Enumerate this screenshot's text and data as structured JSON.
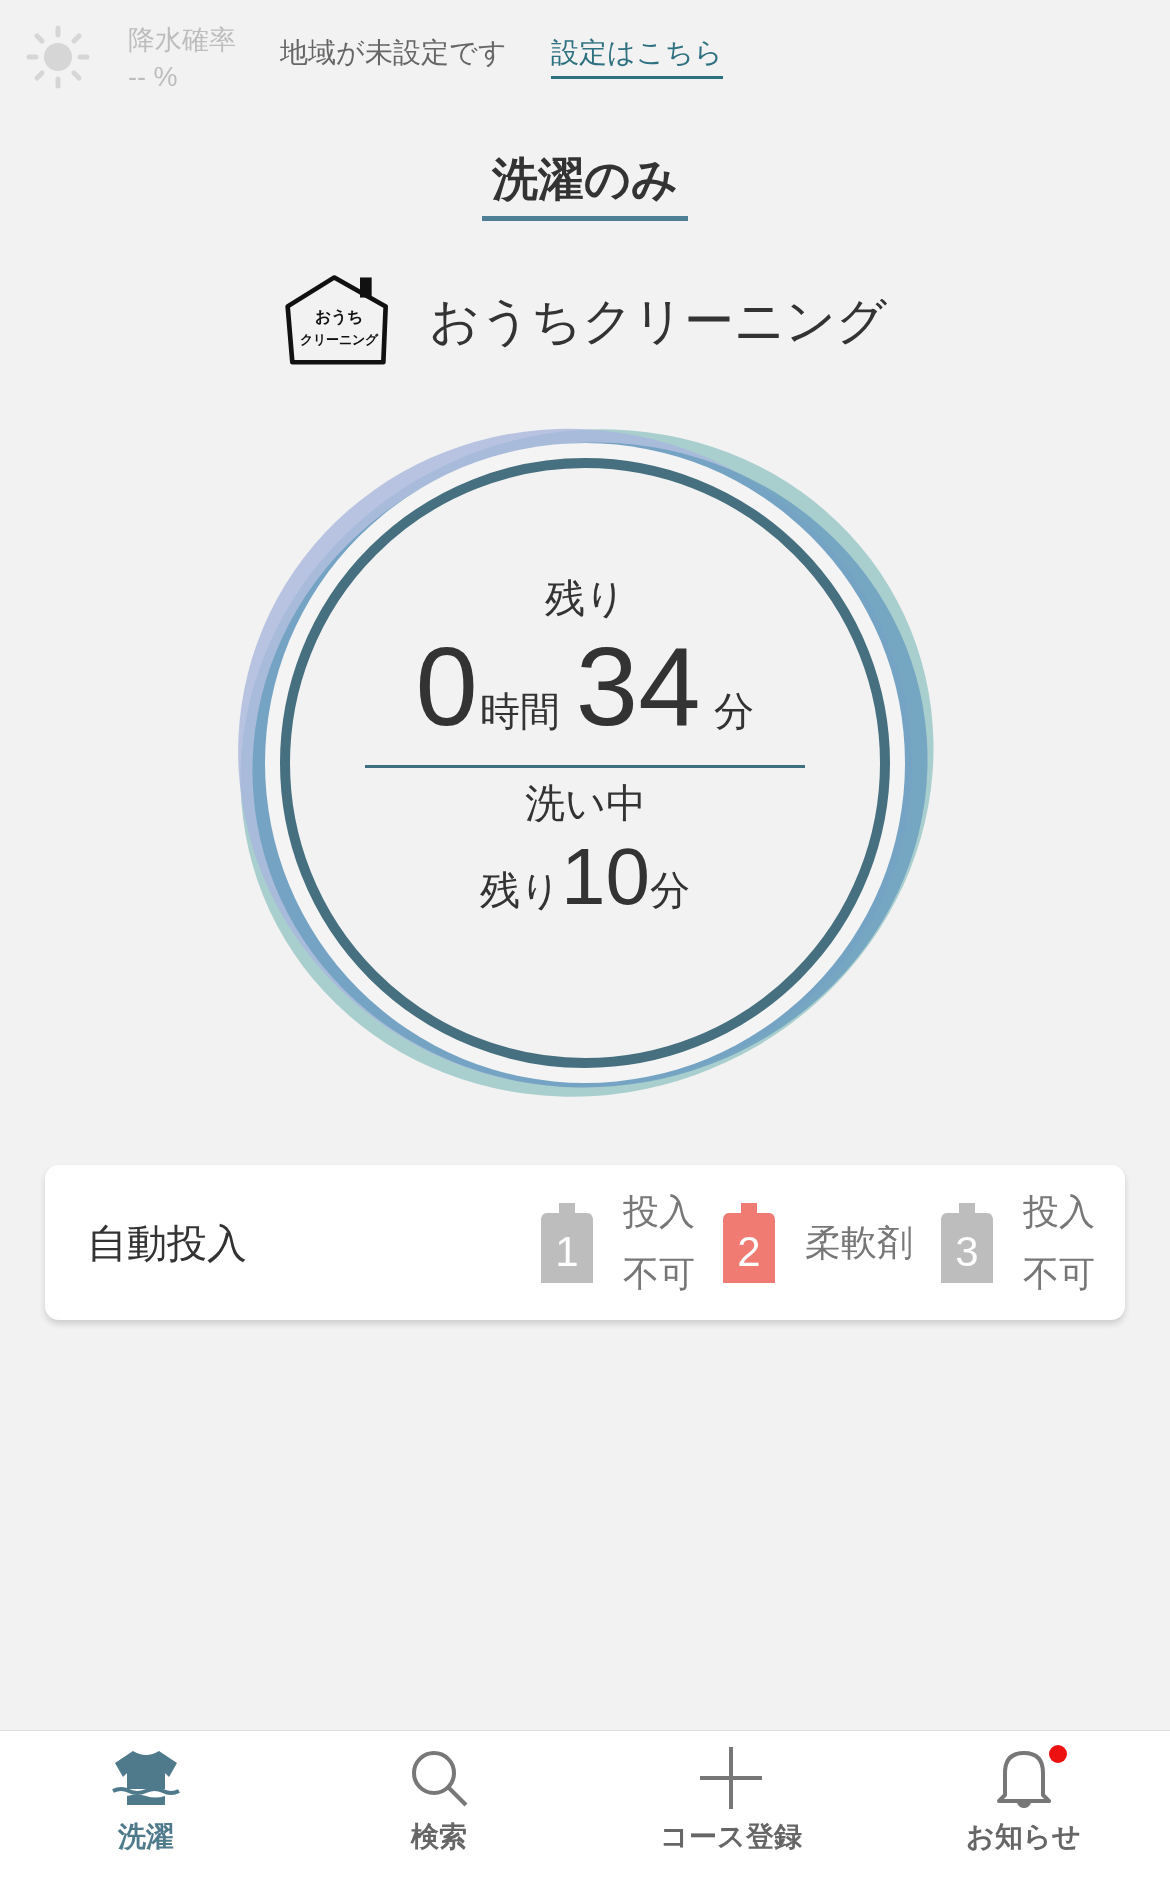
{
  "weather": {
    "label": "降水確率",
    "value": "-- %"
  },
  "region": {
    "message": "地域が未設定です",
    "link": "設定はこちら"
  },
  "course_tab": {
    "label": "洗濯のみ"
  },
  "course": {
    "logo_lines": [
      "おうち",
      "クリーニング"
    ],
    "name": "おうちクリーニング"
  },
  "status": {
    "remaining_label": "残り",
    "hours": "0",
    "hours_unit": "時間",
    "minutes": "34",
    "minutes_unit": "分",
    "phase": "洗い中",
    "phase_remaining_label": "残り",
    "phase_minutes": "10",
    "phase_minutes_unit": "分"
  },
  "auto_dispense": {
    "label": "自動投入",
    "tanks": [
      {
        "number": "1",
        "color": "#bdbdbd",
        "lines": [
          "投入",
          "不可"
        ]
      },
      {
        "number": "2",
        "color": "#ef7b72",
        "lines": [
          "柔軟剤"
        ]
      },
      {
        "number": "3",
        "color": "#bdbdbd",
        "lines": [
          "投入",
          "不可"
        ]
      }
    ]
  },
  "nav": [
    {
      "kind": "laundry",
      "label": "洗濯",
      "selected": true,
      "badge": false
    },
    {
      "kind": "search",
      "label": "検索",
      "selected": false,
      "badge": false
    },
    {
      "kind": "add",
      "label": "コース登録",
      "selected": false,
      "badge": false
    },
    {
      "kind": "notifications",
      "label": "お知らせ",
      "selected": false,
      "badge": true
    }
  ]
}
